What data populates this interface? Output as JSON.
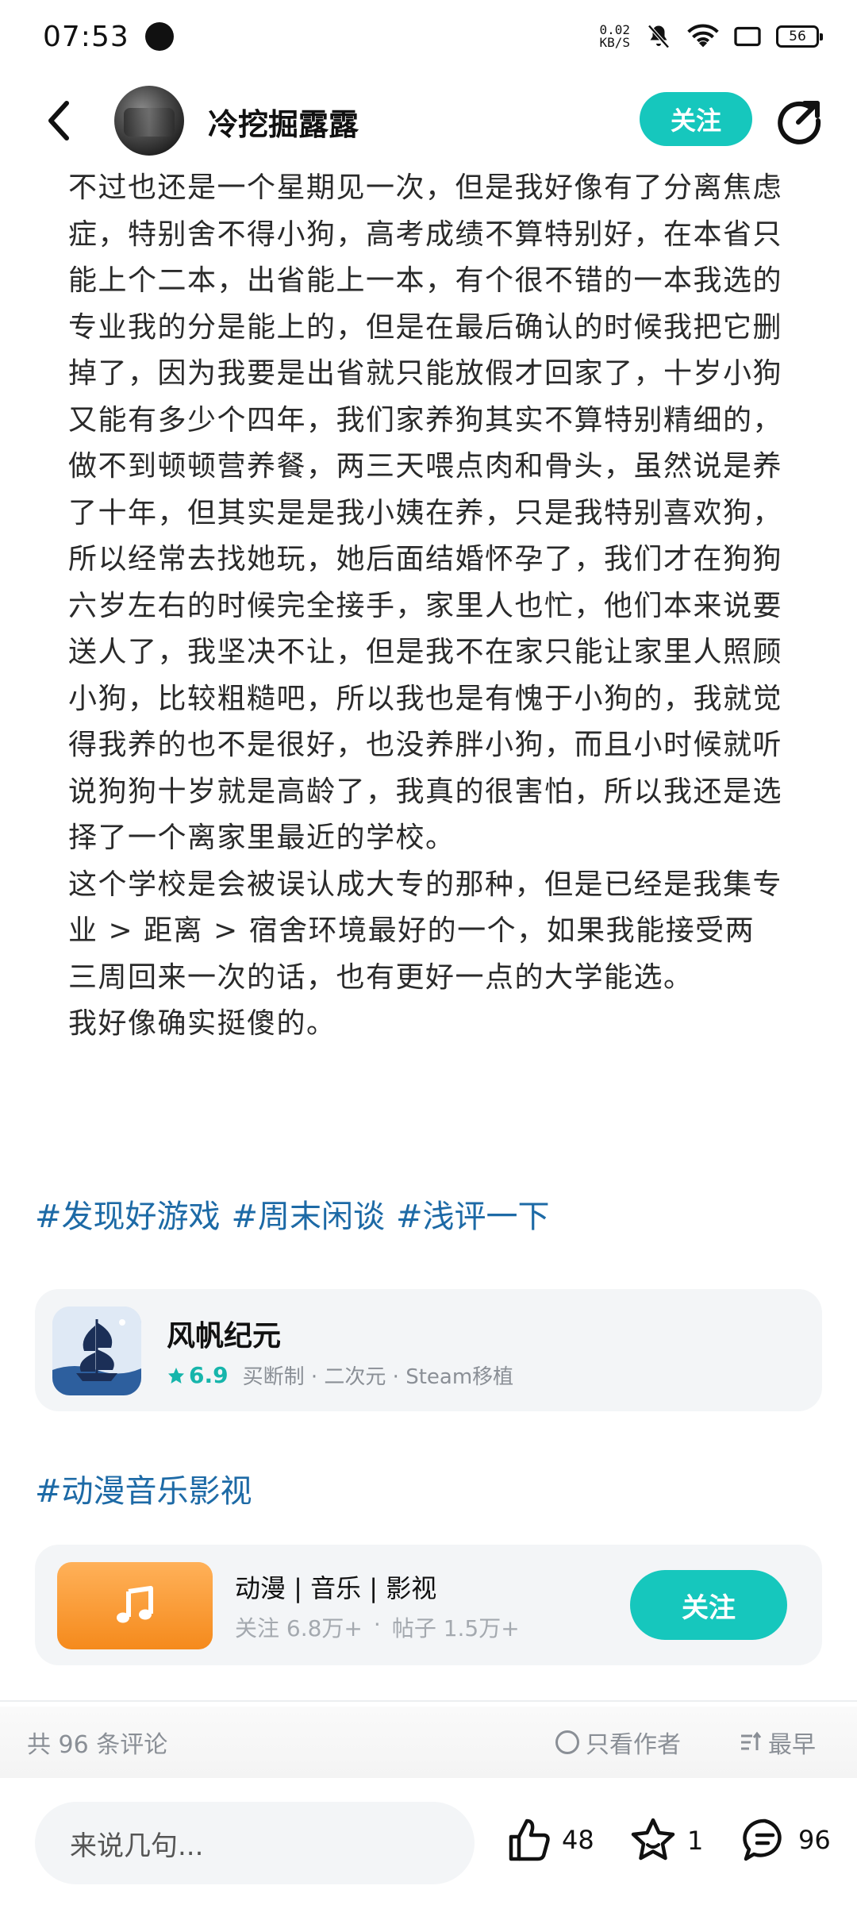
{
  "status_bar": {
    "time": "07:53",
    "net_speed_value": "0.02",
    "net_speed_unit": "KB/S",
    "battery": "56"
  },
  "header": {
    "author_name": "冷挖掘露露",
    "follow_label": "关注"
  },
  "article": {
    "paragraphs": [
      "不过也还是一个星期见一次，但是我好像有了分离焦虑症，特别舍不得小狗，高考成绩不算特别好，在本省只能上个二本，出省能上一本，有个很不错的一本我选的专业我的分是能上的，但是在最后确认的时候我把它删掉了，因为我要是出省就只能放假才回家了，十岁小狗又能有多少个四年，我们家养狗其实不算特别精细的，做不到顿顿营养餐，两三天喂点肉和骨头，虽然说是养了十年，但其实是是我小姨在养，只是我特别喜欢狗，所以经常去找她玩，她后面结婚怀孕了，我们才在狗狗六岁左右的时候完全接手，家里人也忙，他们本来说要送人了，我坚决不让，但是我不在家只能让家里人照顾小狗，比较粗糙吧，所以我也是有愧于小狗的，我就觉得我养的也不是很好，也没养胖小狗，而且小时候就听说狗狗十岁就是高龄了，我真的很害怕，所以我还是选择了一个离家里最近的学校。",
      "这个学校是会被误认成大专的那种，但是已经是我集专业 > 距离 > 宿舍环境最好的一个，如果我能接受两三周回来一次的话，也有更好一点的大学能选。",
      "我好像确实挺傻的。"
    ]
  },
  "tags": [
    "#发现好游戏",
    "#周末闲谈",
    "#浅评一下"
  ],
  "game_card": {
    "title": "风帆纪元",
    "rating": "6.9",
    "meta": "买断制 · 二次元 · Steam移植"
  },
  "topic_tag": "#动漫音乐影视",
  "topic_card": {
    "title": "动漫 | 音乐 | 影视",
    "followers": "关注 6.8万+",
    "separator": "·",
    "posts": "帖子 1.5万+",
    "follow_label": "关注"
  },
  "comments_bar": {
    "count_text": "共 96 条评论",
    "author_only": "只看作者",
    "sort": "最早"
  },
  "bottom_bar": {
    "input_placeholder": "来说几句...",
    "likes": "48",
    "favorites": "1",
    "comments": "96"
  },
  "colors": {
    "accent": "#16c7bd",
    "tag_link": "#1d6aa6",
    "card_bg": "#f3f5f7",
    "muted_text": "#8a8f96",
    "topic_icon_orange": "#f58a1c"
  },
  "icons": {
    "back": "chevron-left-icon",
    "share": "share-icon",
    "rating": "star-icon",
    "topic": "music-note-icon",
    "like": "thumbs-up-icon",
    "favorite": "star-outline-icon",
    "comment": "comment-icon",
    "sort": "sort-icon"
  }
}
